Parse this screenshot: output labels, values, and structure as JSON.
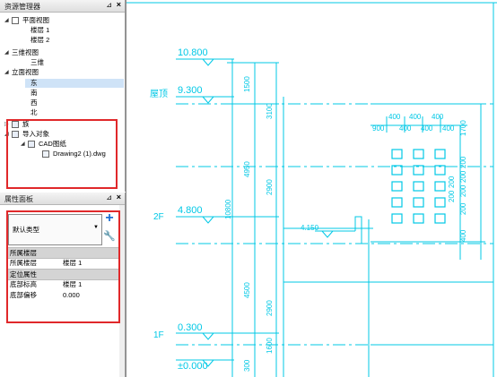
{
  "resource_panel": {
    "title": "资源管理器",
    "tree": [
      {
        "label": "平面视图",
        "expanded": true
      },
      {
        "label": "楼层 1"
      },
      {
        "label": "楼层 2"
      },
      {
        "label": "三维视图",
        "expanded": true
      },
      {
        "label": "三维"
      },
      {
        "label": "立面视图",
        "expanded": true
      },
      {
        "label": "东",
        "selected": true
      },
      {
        "label": "南"
      },
      {
        "label": "西"
      },
      {
        "label": "北"
      },
      {
        "label": "族",
        "expanded": false
      },
      {
        "label": "导入对象",
        "expanded": true
      },
      {
        "label": "CAD图纸",
        "expanded": true
      },
      {
        "label": "Drawing2 (1).dwg"
      }
    ]
  },
  "property_panel": {
    "title": "属性面板",
    "type_selector": "默认类型",
    "sections": [
      {
        "header": "所属楼层",
        "rows": [
          {
            "name": "所属楼层",
            "value": "楼层 1"
          }
        ]
      },
      {
        "header": "定位属性",
        "rows": [
          {
            "name": "底部标高",
            "value": "楼层 1"
          },
          {
            "name": "底部偏移",
            "value": "0.000"
          }
        ]
      }
    ]
  },
  "drawing": {
    "levels": [
      {
        "value": "10.800"
      },
      {
        "value": "9.300",
        "label": "屋顶"
      },
      {
        "value": "4.800",
        "label": "2F"
      },
      {
        "value": "0.300",
        "label": "1F"
      },
      {
        "value": "±0.000"
      }
    ],
    "dims_left": [
      "1500",
      "3100",
      "4950",
      "2900",
      "10800",
      "4500",
      "2900",
      "1600",
      "300"
    ],
    "dims_top": [
      "400",
      "400",
      "400",
      "900",
      "400",
      "400",
      "400"
    ],
    "dims_right": [
      "1700",
      "200",
      "200",
      "200",
      "200",
      "200",
      "200",
      "400"
    ],
    "small_level": "4.150",
    "line_color": "#00c8e6",
    "accent_red": "#e0282a"
  }
}
